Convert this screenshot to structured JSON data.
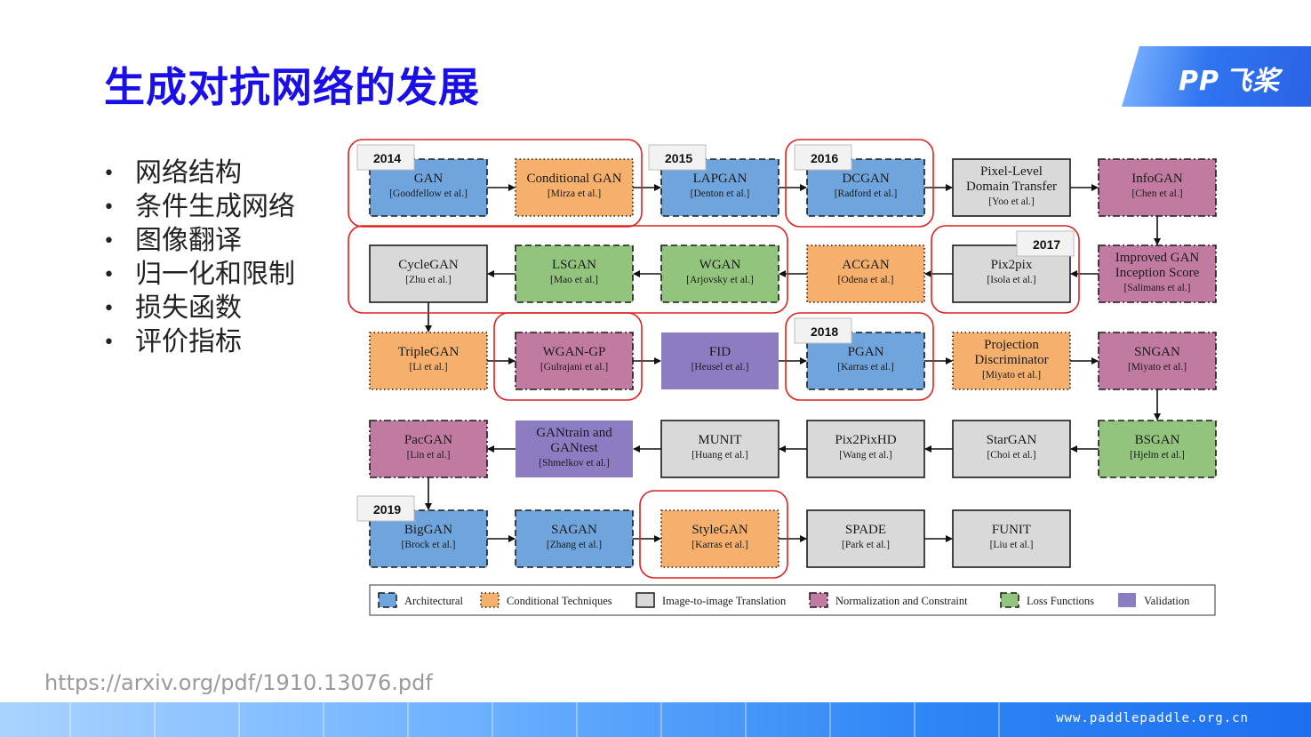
{
  "title": "生成对抗网络的发展",
  "bullets": [
    "网络结构",
    "条件生成网络",
    "图像翻译",
    "归一化和限制",
    "损失函数",
    "评价指标"
  ],
  "logo": {
    "text": "飞桨",
    "mark": "PP"
  },
  "source_url": "https://arxiv.org/pdf/1910.13076.pdf",
  "footer_site": "www.paddlepaddle.org.cn",
  "colors": {
    "architectural": "#6fa5dc",
    "conditional": "#f5b06e",
    "image_translation": "#d9d9d9",
    "normalization": "#c27ba0",
    "loss": "#93c47d",
    "validation": "#8e7cc3",
    "highlight": "#e02020",
    "title": "#1a0fe6"
  },
  "nodes": [
    {
      "id": "gan",
      "name": [
        "GAN"
      ],
      "cite": "[Goodfellow et al.]",
      "cat": "architectural",
      "border": "dashed",
      "row": 0,
      "col": 0
    },
    {
      "id": "cgan",
      "name": [
        "Conditional GAN"
      ],
      "cite": "[Mirza et al.]",
      "cat": "conditional",
      "border": "dotted",
      "row": 0,
      "col": 1
    },
    {
      "id": "lapgan",
      "name": [
        "LAPGAN"
      ],
      "cite": "[Denton et al.]",
      "cat": "architectural",
      "border": "dashed",
      "row": 0,
      "col": 2
    },
    {
      "id": "dcgan",
      "name": [
        "DCGAN"
      ],
      "cite": "[Radford et al.]",
      "cat": "architectural",
      "border": "dashed",
      "row": 0,
      "col": 3
    },
    {
      "id": "pixel",
      "name": [
        "Pixel-Level",
        "Domain Transfer"
      ],
      "cite": "[Yoo et al.]",
      "cat": "image_translation",
      "border": "solid",
      "row": 0,
      "col": 4
    },
    {
      "id": "infogan",
      "name": [
        "InfoGAN"
      ],
      "cite": "[Chen et al.]",
      "cat": "normalization",
      "border": "dashdot",
      "row": 0,
      "col": 5
    },
    {
      "id": "cyclegan",
      "name": [
        "CycleGAN"
      ],
      "cite": "[Zhu et al.]",
      "cat": "image_translation",
      "border": "solid",
      "row": 1,
      "col": 0
    },
    {
      "id": "lsgan",
      "name": [
        "LSGAN"
      ],
      "cite": "[Mao et al.]",
      "cat": "loss",
      "border": "dashed",
      "row": 1,
      "col": 1
    },
    {
      "id": "wgan",
      "name": [
        "WGAN"
      ],
      "cite": "[Arjovsky et al.]",
      "cat": "loss",
      "border": "dashed",
      "row": 1,
      "col": 2
    },
    {
      "id": "acgan",
      "name": [
        "ACGAN"
      ],
      "cite": "[Odena et al.]",
      "cat": "conditional",
      "border": "dotted",
      "row": 1,
      "col": 3
    },
    {
      "id": "pix2pix",
      "name": [
        "Pix2pix"
      ],
      "cite": "[Isola et al.]",
      "cat": "image_translation",
      "border": "solid",
      "row": 1,
      "col": 4
    },
    {
      "id": "improved",
      "name": [
        "Improved GAN",
        "Inception Score"
      ],
      "cite": "[Salimans et al.]",
      "cat": "normalization",
      "border": "dashdot",
      "row": 1,
      "col": 5
    },
    {
      "id": "triplegan",
      "name": [
        "TripleGAN"
      ],
      "cite": "[Li et al.]",
      "cat": "conditional",
      "border": "dotted",
      "row": 2,
      "col": 0
    },
    {
      "id": "wgangp",
      "name": [
        "WGAN-GP"
      ],
      "cite": "[Gulrajani et al.]",
      "cat": "normalization",
      "border": "dashdot",
      "row": 2,
      "col": 1
    },
    {
      "id": "fid",
      "name": [
        "FID"
      ],
      "cite": "[Heusel et al.]",
      "cat": "validation",
      "border": "none",
      "row": 2,
      "col": 2
    },
    {
      "id": "pgan",
      "name": [
        "PGAN"
      ],
      "cite": "[Karras et al.]",
      "cat": "architectural",
      "border": "dashed",
      "row": 2,
      "col": 3
    },
    {
      "id": "projection",
      "name": [
        "Projection",
        "Discriminator"
      ],
      "cite": "[Miyato et al.]",
      "cat": "conditional",
      "border": "dotted",
      "row": 2,
      "col": 4
    },
    {
      "id": "sngan",
      "name": [
        "SNGAN"
      ],
      "cite": "[Miyato et al.]",
      "cat": "normalization",
      "border": "dashdot",
      "row": 2,
      "col": 5
    },
    {
      "id": "pacgan",
      "name": [
        "PacGAN"
      ],
      "cite": "[Lin et al.]",
      "cat": "normalization",
      "border": "dashdot",
      "row": 3,
      "col": 0
    },
    {
      "id": "gantrain",
      "name": [
        "GANtrain and",
        "GANtest"
      ],
      "cite": "[Shmelkov et al.]",
      "cat": "validation",
      "border": "none",
      "row": 3,
      "col": 1
    },
    {
      "id": "munit",
      "name": [
        "MUNIT"
      ],
      "cite": "[Huang et al.]",
      "cat": "image_translation",
      "border": "solid",
      "row": 3,
      "col": 2
    },
    {
      "id": "pix2pixhd",
      "name": [
        "Pix2PixHD"
      ],
      "cite": "[Wang et al.]",
      "cat": "image_translation",
      "border": "solid",
      "row": 3,
      "col": 3
    },
    {
      "id": "stargan",
      "name": [
        "StarGAN"
      ],
      "cite": "[Choi et al.]",
      "cat": "image_translation",
      "border": "solid",
      "row": 3,
      "col": 4
    },
    {
      "id": "bsgan",
      "name": [
        "BSGAN"
      ],
      "cite": "[Hjelm et al.]",
      "cat": "loss",
      "border": "dashed",
      "row": 3,
      "col": 5
    },
    {
      "id": "biggan",
      "name": [
        "BigGAN"
      ],
      "cite": "[Brock et al.]",
      "cat": "architectural",
      "border": "dashed",
      "row": 4,
      "col": 0
    },
    {
      "id": "sagan",
      "name": [
        "SAGAN"
      ],
      "cite": "[Zhang et al.]",
      "cat": "architectural",
      "border": "dashed",
      "row": 4,
      "col": 1
    },
    {
      "id": "stylegan",
      "name": [
        "StyleGAN"
      ],
      "cite": "[Karras et al.]",
      "cat": "conditional",
      "border": "dotted",
      "row": 4,
      "col": 2
    },
    {
      "id": "spade",
      "name": [
        "SPADE"
      ],
      "cite": "[Park et al.]",
      "cat": "image_translation",
      "border": "solid",
      "row": 4,
      "col": 3
    },
    {
      "id": "funit",
      "name": [
        "FUNIT"
      ],
      "cite": "[Liu et al.]",
      "cat": "image_translation",
      "border": "solid",
      "row": 4,
      "col": 4
    }
  ],
  "edges": [
    [
      "gan",
      "cgan"
    ],
    [
      "cgan",
      "lapgan"
    ],
    [
      "lapgan",
      "dcgan"
    ],
    [
      "dcgan",
      "pixel"
    ],
    [
      "pixel",
      "infogan"
    ],
    [
      "infogan",
      "improved"
    ],
    [
      "improved",
      "pix2pix"
    ],
    [
      "pix2pix",
      "acgan"
    ],
    [
      "acgan",
      "wgan"
    ],
    [
      "wgan",
      "lsgan"
    ],
    [
      "lsgan",
      "cyclegan"
    ],
    [
      "cyclegan",
      "triplegan"
    ],
    [
      "triplegan",
      "wgangp"
    ],
    [
      "wgangp",
      "fid"
    ],
    [
      "fid",
      "pgan"
    ],
    [
      "pgan",
      "projection"
    ],
    [
      "projection",
      "sngan"
    ],
    [
      "sngan",
      "bsgan"
    ],
    [
      "bsgan",
      "stargan"
    ],
    [
      "stargan",
      "pix2pixhd"
    ],
    [
      "pix2pixhd",
      "munit"
    ],
    [
      "munit",
      "gantrain"
    ],
    [
      "gantrain",
      "pacgan"
    ],
    [
      "pacgan",
      "biggan"
    ],
    [
      "biggan",
      "sagan"
    ],
    [
      "sagan",
      "stylegan"
    ],
    [
      "stylegan",
      "spade"
    ],
    [
      "spade",
      "funit"
    ]
  ],
  "years": [
    {
      "label": "2014",
      "node": "gan"
    },
    {
      "label": "2015",
      "node": "lapgan"
    },
    {
      "label": "2016",
      "node": "dcgan"
    },
    {
      "label": "2017",
      "node": "pix2pix"
    },
    {
      "label": "2018",
      "node": "pgan"
    },
    {
      "label": "2019",
      "node": "biggan"
    }
  ],
  "highlights": [
    {
      "from": "gan",
      "to": "cgan"
    },
    {
      "from": "dcgan",
      "to": "dcgan"
    },
    {
      "from": "cyclegan",
      "to": "wgan"
    },
    {
      "from": "pix2pix",
      "to": "pix2pix"
    },
    {
      "from": "wgangp",
      "to": "wgangp"
    },
    {
      "from": "pgan",
      "to": "pgan"
    },
    {
      "from": "stylegan",
      "to": "stylegan"
    }
  ],
  "legend": [
    {
      "label": "Architectural",
      "cat": "architectural",
      "border": "dashed"
    },
    {
      "label": "Conditional Techniques",
      "cat": "conditional",
      "border": "dotted"
    },
    {
      "label": "Image-to-image Translation",
      "cat": "image_translation",
      "border": "solid"
    },
    {
      "label": "Normalization and Constraint",
      "cat": "normalization",
      "border": "dashdot"
    },
    {
      "label": "Loss Functions",
      "cat": "loss",
      "border": "dashed"
    },
    {
      "label": "Validation",
      "cat": "validation",
      "border": "none"
    }
  ]
}
